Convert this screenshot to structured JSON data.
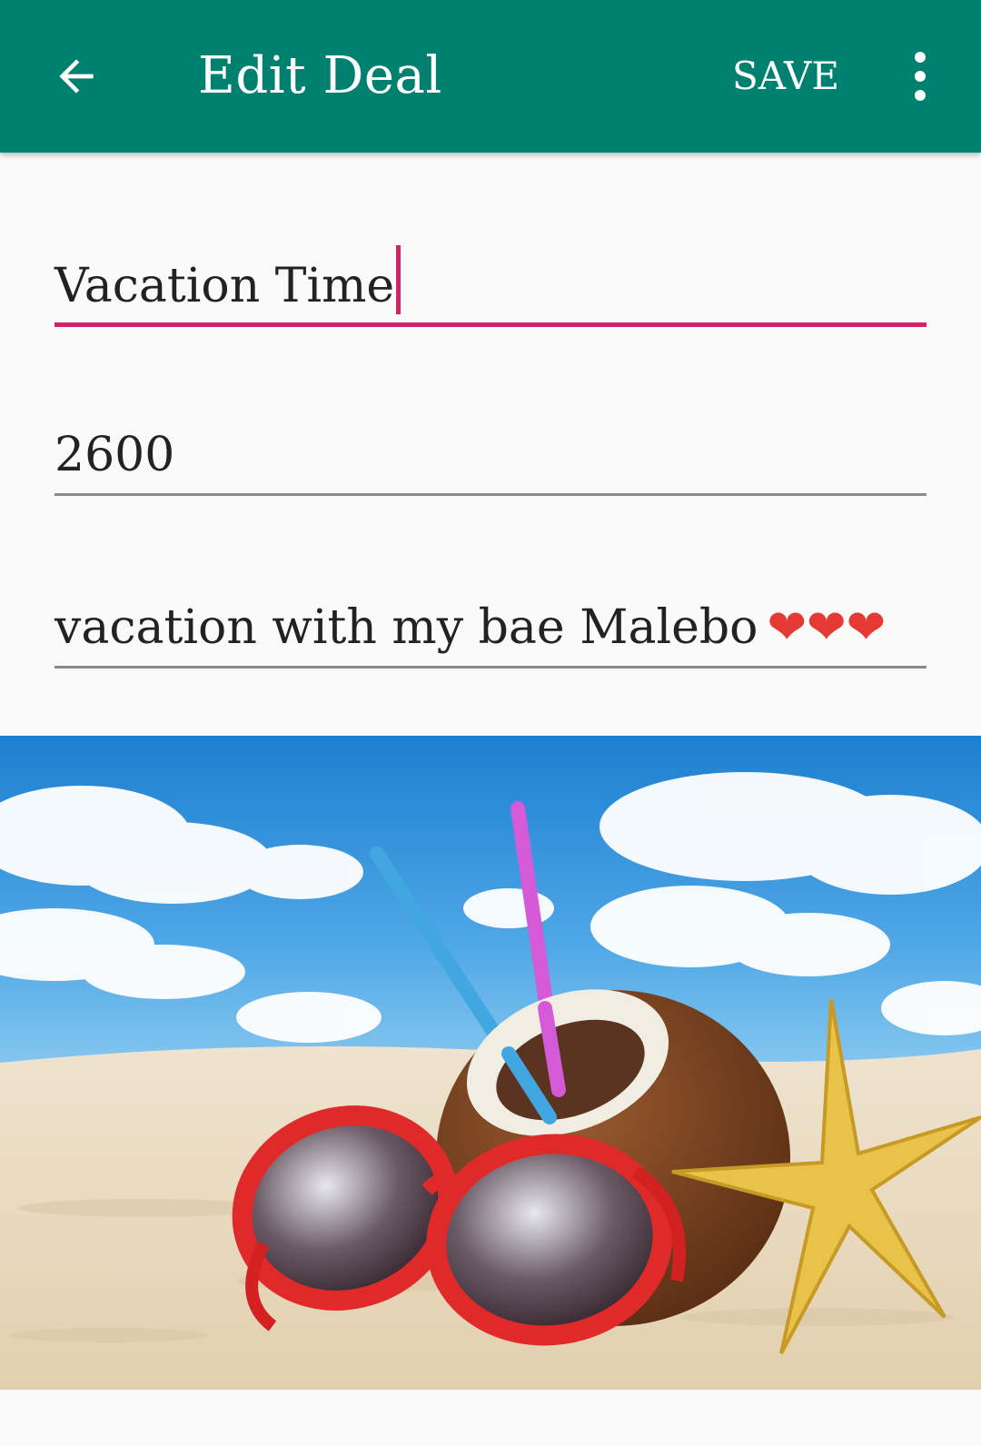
{
  "toolbar": {
    "title": "Edit Deal",
    "save_label": "SAVE",
    "back_icon": "arrow-left-icon",
    "overflow_icon": "more-vert-icon",
    "color": "#00806f"
  },
  "form": {
    "title_value": "Vacation Time",
    "price_value": "2600",
    "description_value": "vacation with my bae Malebo",
    "description_hearts": "❤❤❤",
    "focus_color": "#d0246a"
  },
  "image": {
    "name": "beach-deal-image"
  }
}
